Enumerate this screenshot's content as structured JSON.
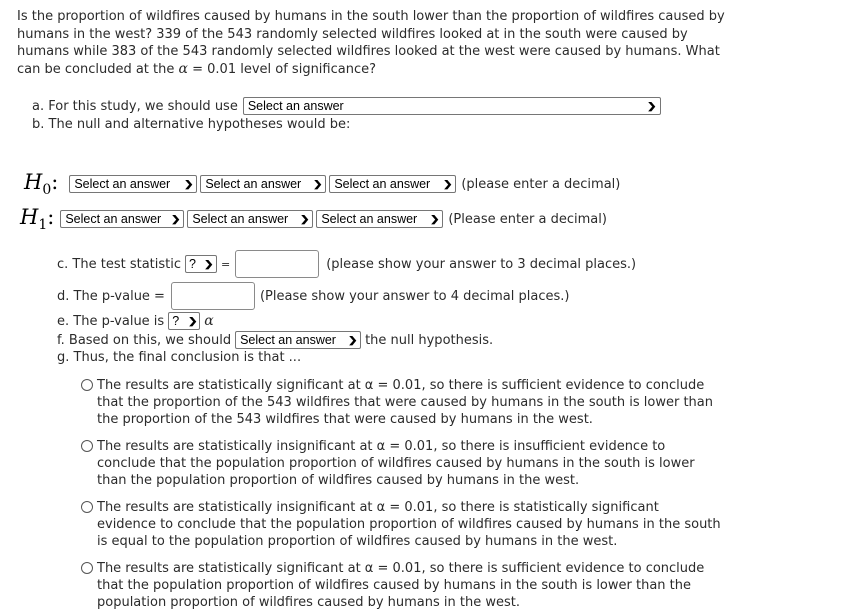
{
  "question": {
    "part1": "Is the proportion of wildfires caused by humans in the south lower than the proportion of wildfires caused by humans in the west? 339 of the 543 randomly selected wildfires looked at in the south were caused by humans while 383 of the 543 randomly selected wildfires looked at the west were caused by humans. What can be concluded at the",
    "alpha_symbol": "α",
    "part2": "= 0.01 level of significance?"
  },
  "part_a": {
    "label": "a. For this study, we should use",
    "select_value": "Select an answer"
  },
  "part_b": {
    "label": "b. The null and alternative hypotheses would be:"
  },
  "h0": {
    "symbol": "H",
    "subscript": "0",
    "colon": ":",
    "selects": [
      "Select an answer",
      "Select an answer",
      "Select an answer"
    ],
    "hint": "(please enter a decimal)"
  },
  "h1": {
    "symbol": "H",
    "subscript": "1",
    "colon": ":",
    "selects": [
      "Select an answer",
      "Select an answer",
      "Select an answer"
    ],
    "hint": "(Please enter a decimal)"
  },
  "part_c": {
    "label": "c. The test statistic",
    "select_value": "?",
    "equals": "=",
    "input_value": "",
    "hint": "(please show your answer to 3 decimal places.)"
  },
  "part_d": {
    "label": "d. The p-value =",
    "input_value": "",
    "hint": "(Please show your answer to 4 decimal places.)"
  },
  "part_e": {
    "label": "e. The p-value is",
    "select_value": "?",
    "alpha_symbol": "α"
  },
  "part_f": {
    "label": "f. Based on this, we should",
    "select_value": "Select an answer",
    "suffix": "the null hypothesis."
  },
  "part_g": {
    "label": "g. Thus, the final conclusion is that ..."
  },
  "options": [
    {
      "text": "The results are statistically significant at α = 0.01, so there is sufficient evidence to conclude that the proportion of the 543 wildfires that were caused by humans in the south is lower than the proportion of the 543 wildfires that were caused by humans in the west.",
      "selected": false
    },
    {
      "text": "The results are statistically insignificant at α = 0.01, so there is insufficient evidence to conclude that the population proportion of wildfires caused by humans in the south is lower than the population proportion of wildfires caused by humans in the west.",
      "selected": false
    },
    {
      "text": "The results are statistically insignificant at α = 0.01, so there is statistically significant evidence to conclude that the population proportion of wildfires caused by humans in the south is equal to the population proportion of wildfires caused by humans in the west.",
      "selected": false
    },
    {
      "text": "The results are statistically significant at α = 0.01, so there is sufficient evidence to conclude that the population proportion of wildfires caused by humans in the south is lower than the population proportion of wildfires caused by humans in the west.",
      "selected": false
    }
  ]
}
